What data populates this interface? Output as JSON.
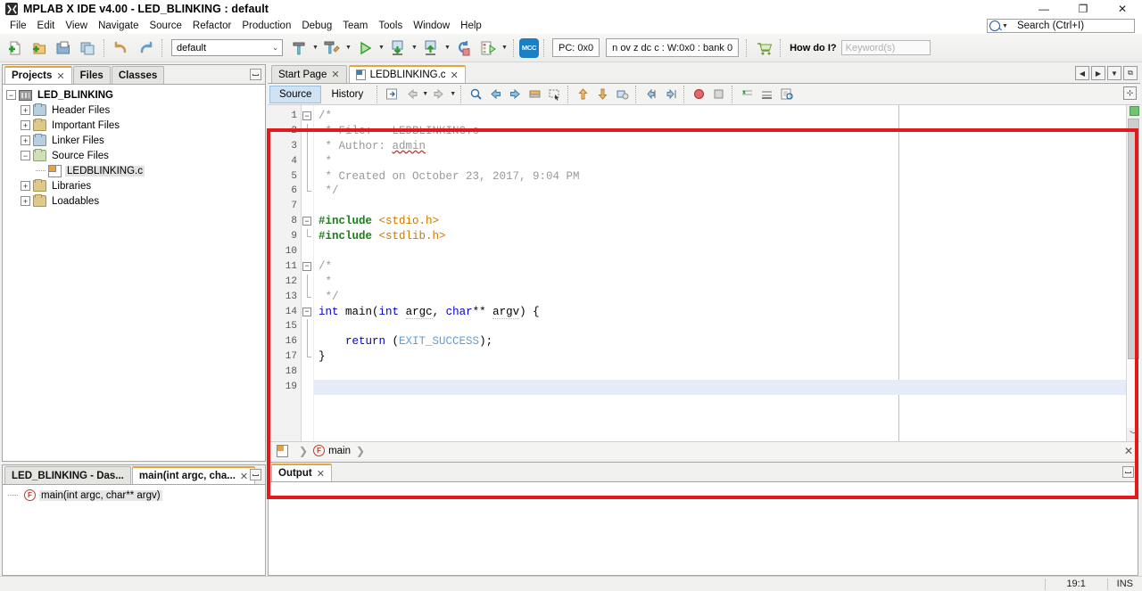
{
  "window": {
    "title": "MPLAB X IDE v4.00 - LED_BLINKING : default",
    "app_icon": "mplab-icon",
    "minimize": "—",
    "maximize": "❐",
    "close": "✕"
  },
  "menubar": {
    "items": [
      "File",
      "Edit",
      "View",
      "Navigate",
      "Source",
      "Refactor",
      "Production",
      "Debug",
      "Team",
      "Tools",
      "Window",
      "Help"
    ]
  },
  "global_search": {
    "placeholder": "Search (Ctrl+I)",
    "icon": "search-icon"
  },
  "toolbar": {
    "config_combo": "default",
    "pc_field": "PC: 0x0",
    "status_register": "n ov z dc c  : W:0x0 : bank 0",
    "mcc_label": "MCC",
    "howdoi_label": "How do I?",
    "howdoi_placeholder": "Keyword(s)",
    "buttons": [
      {
        "name": "new-file-button",
        "icon": "new-file-icon"
      },
      {
        "name": "new-project-button",
        "icon": "new-project-icon"
      },
      {
        "name": "open-project-button",
        "icon": "open-project-icon"
      },
      {
        "name": "save-all-button",
        "icon": "save-all-icon"
      },
      {
        "name": "undo-button",
        "icon": "undo-icon"
      },
      {
        "name": "redo-button",
        "icon": "redo-icon"
      },
      {
        "name": "build-project-button",
        "icon": "hammer-icon"
      },
      {
        "name": "clean-build-button",
        "icon": "hammer-broom-icon"
      },
      {
        "name": "run-project-button",
        "icon": "play-icon"
      },
      {
        "name": "debug-project-button",
        "icon": "debug-down-icon"
      },
      {
        "name": "program-device-button",
        "icon": "program-up-icon"
      },
      {
        "name": "hold-reset-button",
        "icon": "reset-icon"
      },
      {
        "name": "make-and-program-button",
        "icon": "make-program-icon"
      }
    ]
  },
  "projects_panel": {
    "tabs": [
      {
        "label": "Projects",
        "active": true,
        "closable": true
      },
      {
        "label": "Files",
        "active": false,
        "closable": false
      },
      {
        "label": "Classes",
        "active": false,
        "closable": false
      }
    ],
    "tree": [
      {
        "label": "LED_BLINKING",
        "level": 0,
        "expander": "−",
        "icon": "project-icon",
        "bold": true,
        "selected": false
      },
      {
        "label": "Header Files",
        "level": 1,
        "expander": "+",
        "icon": "folder-blue-icon",
        "bold": false,
        "selected": false
      },
      {
        "label": "Important Files",
        "level": 1,
        "expander": "+",
        "icon": "folder-plain-icon",
        "bold": false,
        "selected": false
      },
      {
        "label": "Linker Files",
        "level": 1,
        "expander": "+",
        "icon": "folder-blue-icon",
        "bold": false,
        "selected": false
      },
      {
        "label": "Source Files",
        "level": 1,
        "expander": "−",
        "icon": "folder-green-icon",
        "bold": false,
        "selected": false
      },
      {
        "label": "LEDBLINKING.c",
        "level": 2,
        "expander": "",
        "icon": "c-file-icon",
        "bold": false,
        "selected": true
      },
      {
        "label": "Libraries",
        "level": 1,
        "expander": "+",
        "icon": "folder-plain-icon",
        "bold": false,
        "selected": false
      },
      {
        "label": "Loadables",
        "level": 1,
        "expander": "+",
        "icon": "folder-plain-icon",
        "bold": false,
        "selected": false
      }
    ]
  },
  "navigator_panel": {
    "tabs": [
      {
        "label": "LED_BLINKING - Das...",
        "active": false,
        "closable": false
      },
      {
        "label": "main(int argc, cha...",
        "active": true,
        "closable": true
      }
    ],
    "members": [
      {
        "label": "main(int argc, char** argv)",
        "icon": "method-icon"
      }
    ]
  },
  "editor": {
    "tabs": [
      {
        "label": "Start Page",
        "active": false,
        "closable": true,
        "icon": ""
      },
      {
        "label": "LEDBLINKING.c",
        "active": true,
        "closable": true,
        "icon": "c-file-icon"
      }
    ],
    "tab_controls": [
      {
        "name": "scroll-tabs-left-button",
        "glyph": "◀"
      },
      {
        "name": "scroll-tabs-right-button",
        "glyph": "▶"
      },
      {
        "name": "tab-list-button",
        "glyph": "▼"
      },
      {
        "name": "maximize-editor-button",
        "glyph": "⧉"
      }
    ],
    "view_tabs": [
      {
        "label": "Source",
        "active": true
      },
      {
        "label": "History",
        "active": false
      }
    ],
    "toolbar_icons": [
      {
        "name": "last-edit-icon"
      },
      {
        "name": "back-icon"
      },
      {
        "name": "forward-icon"
      },
      {
        "name": "find-selection-icon"
      },
      {
        "name": "previous-bookmark-icon"
      },
      {
        "name": "next-bookmark-icon"
      },
      {
        "name": "toggle-bookmark-icon"
      },
      {
        "name": "rectangular-selection-icon"
      },
      {
        "name": "previous-error-icon"
      },
      {
        "name": "next-error-icon"
      },
      {
        "name": "toggle-breakpoint-icon"
      },
      {
        "name": "shift-left-icon"
      },
      {
        "name": "shift-right-icon"
      },
      {
        "name": "start-macro-recording-icon"
      },
      {
        "name": "stop-macro-recording-icon"
      },
      {
        "name": "comment-icon"
      },
      {
        "name": "uncomment-icon"
      },
      {
        "name": "inspect-icon"
      }
    ],
    "code_lines": [
      {
        "n": 1,
        "fold": "start",
        "tokens": [
          {
            "t": "/*",
            "c": "cmt"
          }
        ]
      },
      {
        "n": 2,
        "fold": "mid",
        "tokens": [
          {
            "t": " * File:   LEDBLINKING.c",
            "c": "cmt"
          }
        ]
      },
      {
        "n": 3,
        "fold": "mid",
        "tokens": [
          {
            "t": " * Author: ",
            "c": "cmt"
          },
          {
            "t": "admin",
            "c": "cmt sq"
          }
        ]
      },
      {
        "n": 4,
        "fold": "mid",
        "tokens": [
          {
            "t": " *",
            "c": "cmt"
          }
        ]
      },
      {
        "n": 5,
        "fold": "mid",
        "tokens": [
          {
            "t": " * Created on October 23, 2017, 9:04 PM",
            "c": "cmt"
          }
        ]
      },
      {
        "n": 6,
        "fold": "end",
        "tokens": [
          {
            "t": " */",
            "c": "cmt"
          }
        ]
      },
      {
        "n": 7,
        "fold": "none",
        "tokens": []
      },
      {
        "n": 8,
        "fold": "start",
        "tokens": [
          {
            "t": "#include",
            "c": "pp"
          },
          {
            "t": " ",
            "c": ""
          },
          {
            "t": "<stdio.h>",
            "c": "str"
          }
        ]
      },
      {
        "n": 9,
        "fold": "end",
        "tokens": [
          {
            "t": "#include",
            "c": "pp"
          },
          {
            "t": " ",
            "c": ""
          },
          {
            "t": "<stdlib.h>",
            "c": "str"
          }
        ]
      },
      {
        "n": 10,
        "fold": "none",
        "tokens": []
      },
      {
        "n": 11,
        "fold": "start",
        "tokens": [
          {
            "t": "/*",
            "c": "cmt"
          }
        ]
      },
      {
        "n": 12,
        "fold": "mid",
        "tokens": [
          {
            "t": " *",
            "c": "cmt"
          }
        ]
      },
      {
        "n": 13,
        "fold": "end",
        "tokens": [
          {
            "t": " */",
            "c": "cmt"
          }
        ]
      },
      {
        "n": 14,
        "fold": "start",
        "tokens": [
          {
            "t": "int",
            "c": "kw"
          },
          {
            "t": " main(",
            "c": ""
          },
          {
            "t": "int",
            "c": "kw"
          },
          {
            "t": " ",
            "c": ""
          },
          {
            "t": "argc",
            "c": "sqg"
          },
          {
            "t": ", ",
            "c": ""
          },
          {
            "t": "char",
            "c": "kw"
          },
          {
            "t": "** ",
            "c": ""
          },
          {
            "t": "argv",
            "c": "sqg"
          },
          {
            "t": ") {",
            "c": ""
          }
        ]
      },
      {
        "n": 15,
        "fold": "mid",
        "tokens": []
      },
      {
        "n": 16,
        "fold": "mid",
        "tokens": [
          {
            "t": "    ",
            "c": ""
          },
          {
            "t": "return",
            "c": "kw"
          },
          {
            "t": " (",
            "c": ""
          },
          {
            "t": "EXIT_SUCCESS",
            "c": "mac"
          },
          {
            "t": ");",
            "c": ""
          }
        ]
      },
      {
        "n": 17,
        "fold": "end",
        "tokens": [
          {
            "t": "}",
            "c": ""
          }
        ]
      },
      {
        "n": 18,
        "fold": "none",
        "tokens": []
      },
      {
        "n": 19,
        "fold": "none",
        "tokens": [],
        "highlight": true
      }
    ],
    "breadcrumb": [
      {
        "label": "",
        "icon": "c-file-icon"
      },
      {
        "label": "main",
        "icon": "method-icon"
      }
    ],
    "breadcrumb_close": "✕"
  },
  "output_panel": {
    "tabs": [
      {
        "label": "Output",
        "active": true,
        "closable": true
      }
    ],
    "content": ""
  },
  "statusbar": {
    "position": "19:1",
    "insert_mode": "INS"
  },
  "colors": {
    "annotation": "#e01b1b",
    "accent_tab": "#e8a33d",
    "keyword": "#0000cd",
    "comment": "#999999",
    "preprocessor": "#1a7f1a",
    "string": "#cc7a00",
    "macro": "#5f9ed6",
    "selection": "#e6ecf7"
  }
}
